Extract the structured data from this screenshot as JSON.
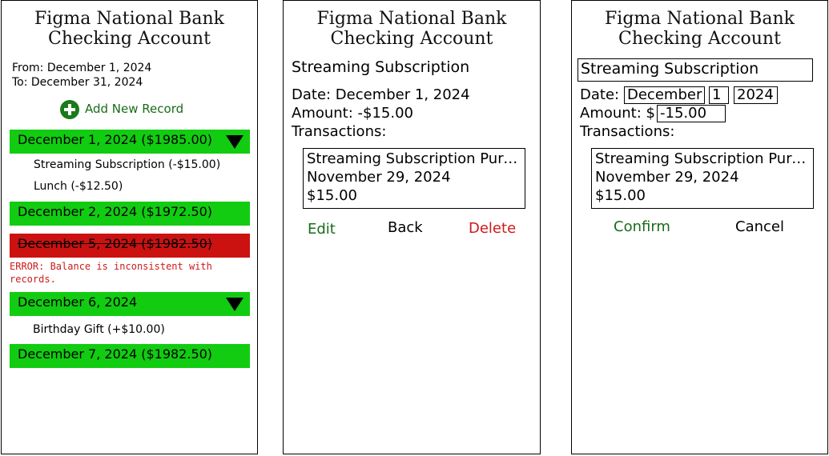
{
  "bank_title": [
    "Figma National Bank",
    "Checking Account"
  ],
  "list_screen": {
    "from": "From: December 1, 2024",
    "to": "To: December 31, 2024",
    "add_record": "Add New Record",
    "days": [
      {
        "label": "December 1, 2024 ($1985.00)",
        "status": "ok",
        "expanded": true,
        "items": [
          "Streaming Subscription (-$15.00)",
          "Lunch (-$12.50)"
        ]
      },
      {
        "label": "December 2, 2024 ($1972.50)",
        "status": "ok",
        "expanded": false,
        "items": []
      },
      {
        "label": "December 5, 2024 ($1982.50)",
        "status": "error",
        "expanded": false,
        "items": [],
        "error": "ERROR: Balance is inconsistent with records."
      },
      {
        "label": "December 6, 2024",
        "status": "ok",
        "expanded": true,
        "items": [
          "Birthday Gift (+$10.00)"
        ]
      },
      {
        "label": "December 7, 2024 ($1982.50)",
        "status": "ok",
        "expanded": false,
        "items": []
      }
    ]
  },
  "detail_screen": {
    "name": "Streaming Subscription",
    "date": "Date: December 1, 2024",
    "amount": "Amount: -$15.00",
    "transactions_label": "Transactions:",
    "transaction": [
      "Streaming Subscription Purchase",
      "November 29, 2024",
      "$15.00"
    ],
    "edit": "Edit",
    "back": "Back",
    "delete": "Delete"
  },
  "edit_screen": {
    "name_value": "Streaming Subscription",
    "date_label": "Date:",
    "month": "December",
    "day": "1",
    "year": "2024",
    "amount_label": "Amount: $",
    "amount_value": "-15.00",
    "transactions_label": "Transactions:",
    "transaction": [
      "Streaming Subscription Purchase",
      "November 29, 2024",
      "$15.00"
    ],
    "confirm": "Confirm",
    "cancel": "Cancel"
  },
  "colors": {
    "ok": "#11cc11",
    "error": "#cc1111",
    "positive_text": "#1a6b1a",
    "negative_text": "#cc1a1a"
  }
}
